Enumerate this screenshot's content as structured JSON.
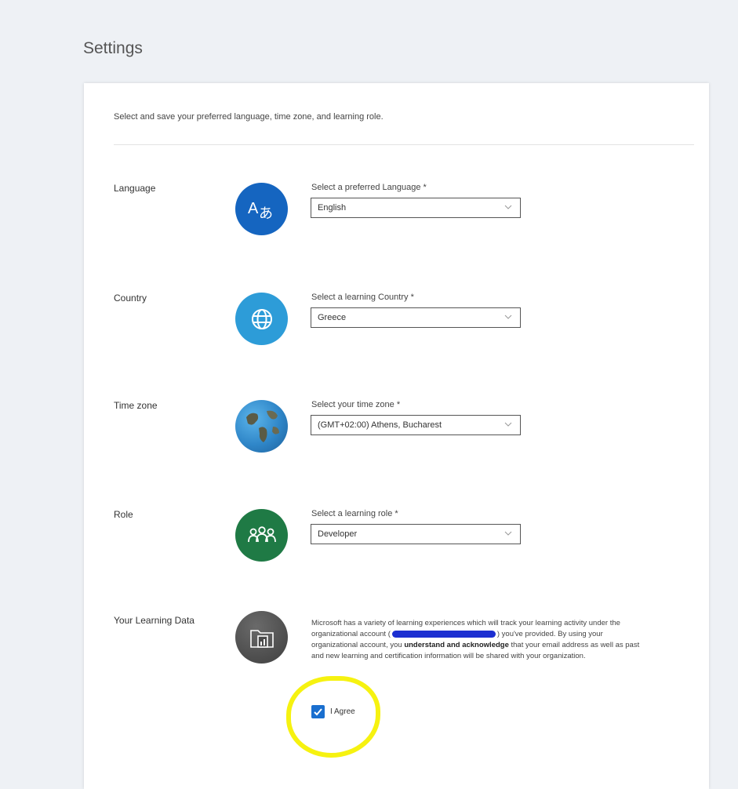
{
  "page": {
    "title": "Settings"
  },
  "intro": "Select and save your preferred language, time zone, and learning role.",
  "rows": {
    "language": {
      "label": "Language",
      "field_label": "Select a preferred Language *",
      "value": "English",
      "icon": "language-translate-icon",
      "color": "#1565c0"
    },
    "country": {
      "label": "Country",
      "field_label": "Select a learning Country *",
      "value": "Greece",
      "icon": "globe-icon",
      "color": "#2d9cd8"
    },
    "timezone": {
      "label": "Time zone",
      "field_label": "Select your time zone *",
      "value": "(GMT+02:00) Athens, Bucharest",
      "icon": "earth-icon",
      "color": "#2f86c8"
    },
    "role": {
      "label": "Role",
      "field_label": "Select a learning role *",
      "value": "Developer",
      "icon": "people-icon",
      "color": "#1f7a45"
    },
    "learning_data": {
      "label": "Your Learning Data",
      "icon": "document-folder-icon",
      "color": "#4a4a4a",
      "text_1": "Microsoft has a variety of learning experiences which will track your learning activity under the organizational account (",
      "text_2": ") you've provided. By using your organizational account, you ",
      "bold_1": "understand and acknowledge",
      "text_3": " that your email address as well as past and new learning and certification information will be shared with your organization.",
      "checkbox_label": "I Agree",
      "checkbox_checked": true
    }
  },
  "colors": {
    "accent": "#1a6fcf",
    "highlight": "#f6f210",
    "redaction": "#1c2fd1"
  }
}
